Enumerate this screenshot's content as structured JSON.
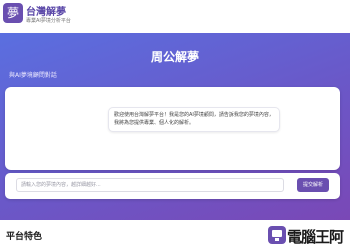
{
  "header": {
    "logo_char": "夢",
    "brand_name": "台灣解夢",
    "brand_tagline": "專業AI夢境分析平台"
  },
  "hero": {
    "title": "周公解夢",
    "subtitle": "與AI夢境顧問對話"
  },
  "chat": {
    "welcome_message": "歡迎使用台灣解夢平台！我是您的AI夢境顧問，請告訴我您的夢境內容，我將為您提供專業、個人化的解析。"
  },
  "input": {
    "placeholder": "請輸入您的夢境內容，越詳細越好...",
    "submit_label": "提交解析"
  },
  "features": {
    "title": "平台特色"
  },
  "watermark": {
    "text": "電腦王阿"
  },
  "colors": {
    "brand": "#6a4fb0",
    "hero_gradient_start": "#5a6fe0",
    "hero_gradient_end": "#7a48b6"
  }
}
